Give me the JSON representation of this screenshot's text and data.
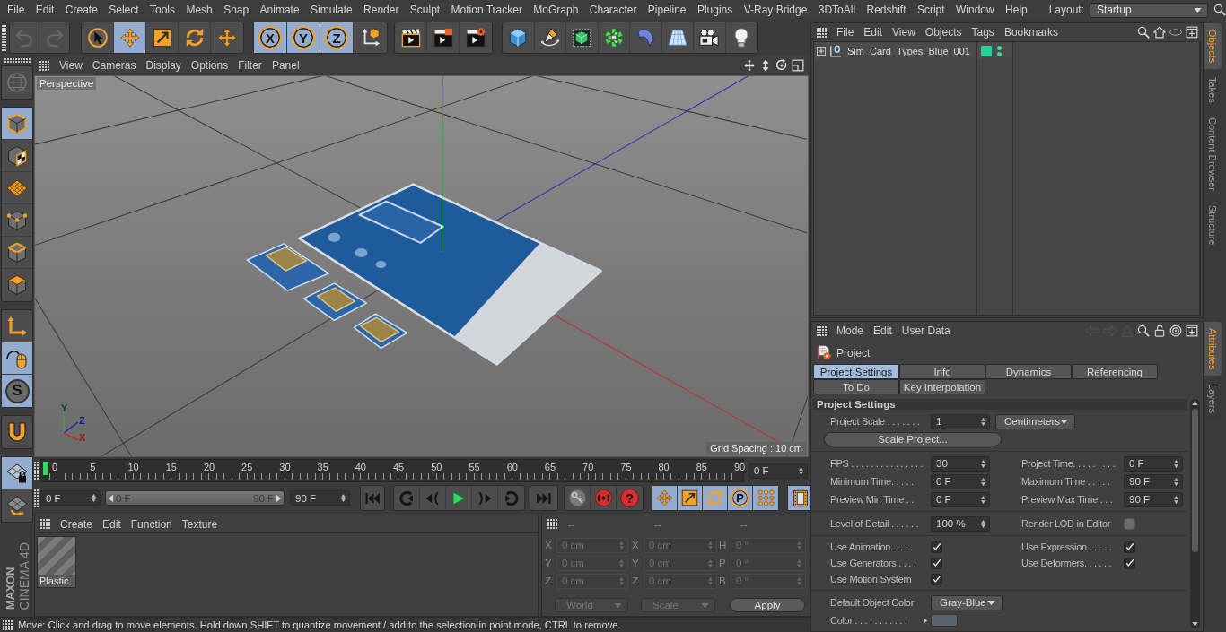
{
  "menu_bar": {
    "items": [
      "File",
      "Edit",
      "Create",
      "Select",
      "Tools",
      "Mesh",
      "Snap",
      "Animate",
      "Simulate",
      "Render",
      "Sculpt",
      "Motion Tracker",
      "MoGraph",
      "Character",
      "Pipeline",
      "Plugins",
      "V-Ray Bridge",
      "3DToAll",
      "Redshift",
      "Script",
      "Window",
      "Help"
    ],
    "layout_label": "Layout:",
    "layout": "Startup"
  },
  "toolbar": {
    "history": [
      {
        "disabled": true
      },
      {
        "disabled": true
      }
    ],
    "tools": [
      {
        "selected": false
      },
      {
        "selected": true
      },
      {
        "selected": false
      },
      {
        "selected": false
      },
      {
        "selected": false
      }
    ],
    "axis_locks": [
      {
        "label": "X",
        "selected": true
      },
      {
        "label": "Y",
        "selected": true
      },
      {
        "label": "Z",
        "selected": true
      }
    ]
  },
  "mode_toolbar": {
    "camera_button": {
      "disabled": true
    },
    "modes": [
      {
        "selected": true
      },
      {
        "selected": false
      },
      {
        "selected": false
      },
      {
        "selected": false
      },
      {
        "selected": false
      },
      {
        "selected": false
      }
    ],
    "helpers": [
      {
        "selected": false
      },
      {
        "selected": true
      },
      {
        "label": "S",
        "selected": true
      }
    ],
    "magnet": {
      "selected": false
    },
    "workplane": [
      {
        "selected": true
      },
      {
        "selected": false
      }
    ]
  },
  "viewport": {
    "menu": [
      "View",
      "Cameras",
      "Display",
      "Options",
      "Filter",
      "Panel"
    ],
    "camera": "Perspective",
    "grid_spacing": "Grid Spacing : 10 cm",
    "axis_labels": [
      "Y",
      "Z",
      "X"
    ]
  },
  "timeline": {
    "ticks": [
      "0",
      "5",
      "10",
      "15",
      "20",
      "25",
      "30",
      "35",
      "40",
      "45",
      "50",
      "55",
      "60",
      "65",
      "70",
      "75",
      "80",
      "85",
      "90"
    ],
    "playhead": {
      "level": 0
    },
    "frame_field": "0 F"
  },
  "transport": {
    "start": "0 F",
    "range": {
      "start": "0 F",
      "end": "90 F",
      "level": 1
    },
    "end": "90 F",
    "key_selection_label": "?",
    "key_tracks": [
      {
        "selected": true
      },
      {
        "selected": true
      },
      {
        "selected": true
      },
      {
        "label": "P",
        "selected": true
      },
      {
        "selected": true
      }
    ],
    "timeline_button": {
      "selected": true
    }
  },
  "material_manager": {
    "menu": [
      "Create",
      "Edit",
      "Function",
      "Texture"
    ],
    "materials": [
      {
        "name": "Plastic"
      }
    ]
  },
  "coordinates": {
    "disabled": true,
    "headers": [
      "--",
      "--",
      "--"
    ],
    "rows": [
      {
        "cells": [
          {
            "axis": "X",
            "value": "0 cm"
          },
          {
            "axis": "X",
            "value": "0 cm"
          },
          {
            "axis": "H",
            "value": "0 °"
          }
        ]
      },
      {
        "cells": [
          {
            "axis": "Y",
            "value": "0 cm"
          },
          {
            "axis": "Y",
            "value": "0 cm"
          },
          {
            "axis": "P",
            "value": "0 °"
          }
        ]
      },
      {
        "cells": [
          {
            "axis": "Z",
            "value": "0 cm"
          },
          {
            "axis": "Z",
            "value": "0 cm"
          },
          {
            "axis": "B",
            "value": "0 °"
          }
        ]
      }
    ],
    "dropdowns": [
      "World",
      "Scale"
    ],
    "apply": "Apply"
  },
  "logo": {
    "brand": "MAXON",
    "product": "CINEMA 4D"
  },
  "status_bar": "Move: Click and drag to move elements. Hold down SHIFT to quantize movement / add to the selection in point mode, CTRL to remove.",
  "object_manager": {
    "menu": [
      "File",
      "Edit",
      "View",
      "Objects",
      "Tags",
      "Bookmarks"
    ],
    "objects": [
      {
        "name": "Sim_Card_Types_Blue_001",
        "expanded": false,
        "color": "#22d39b",
        "editor_visible": true,
        "render_visible": true
      }
    ]
  },
  "dock_tabs_top": [
    {
      "label": "Objects",
      "selected": true
    },
    {
      "label": "Takes",
      "selected": false
    },
    {
      "label": "Content Browser",
      "selected": false
    },
    {
      "label": "Structure",
      "selected": false
    }
  ],
  "attributes": {
    "menu": [
      "Mode",
      "Edit",
      "User Data"
    ],
    "title": "Project",
    "tabs": [
      {
        "label": "Project Settings",
        "selected": true
      },
      {
        "label": "Info",
        "selected": false
      },
      {
        "label": "Dynamics",
        "selected": false
      },
      {
        "label": "Referencing",
        "selected": false
      },
      {
        "label": "To Do",
        "selected": false
      },
      {
        "label": "Key Interpolation",
        "selected": false
      }
    ],
    "section": "Project Settings",
    "groups": [
      {
        "rows": [
          [
            {
              "kind": "number",
              "label": "Project Scale . . . . . . .",
              "value": "1",
              "unit": "Centimeters"
            }
          ],
          [
            {
              "kind": "button",
              "label": "Scale Project..."
            }
          ]
        ]
      },
      {
        "rows": [
          [
            {
              "kind": "number",
              "label": "FPS . . . . . . . . . . . . . . .",
              "value": "30"
            },
            {
              "kind": "number",
              "label": "Project Time. . . . . . . . .",
              "value": "0 F"
            }
          ],
          [
            {
              "kind": "number",
              "label": "Minimum Time. . . . .",
              "value": "0 F"
            },
            {
              "kind": "number",
              "label": "Maximum Time . . . . .",
              "value": "90 F"
            }
          ],
          [
            {
              "kind": "number",
              "label": "Preview Min Time . .",
              "value": "0 F"
            },
            {
              "kind": "number",
              "label": "Preview Max Time . . .",
              "value": "90 F"
            }
          ]
        ]
      },
      {
        "rows": [
          [
            {
              "kind": "number",
              "label": "Level of Detail . . . . . .",
              "value": "100 %"
            },
            {
              "kind": "checkbox",
              "label": "Render LOD in Editor",
              "checked": false
            }
          ]
        ]
      },
      {
        "rows": [
          [
            {
              "kind": "checkbox",
              "label": "Use Animation. . . . .",
              "checked": true
            },
            {
              "kind": "checkbox",
              "label": "Use Expression . . . . .",
              "checked": true
            }
          ],
          [
            {
              "kind": "checkbox",
              "label": "Use Generators . . . .",
              "checked": true
            },
            {
              "kind": "checkbox",
              "label": "Use Deformers. . . . . .",
              "checked": true
            }
          ],
          [
            {
              "kind": "checkbox",
              "label": "Use Motion System",
              "checked": true
            }
          ]
        ]
      },
      {
        "rows": [
          [
            {
              "kind": "dropdown",
              "label": "Default Object Color",
              "value": "Gray-Blue"
            }
          ],
          [
            {
              "kind": "color",
              "label": "Color . . . . . . . . . . .",
              "color": "#59626c"
            }
          ]
        ]
      }
    ]
  },
  "dock_tabs_bottom": [
    {
      "label": "Attributes",
      "selected": true
    },
    {
      "label": "Layers",
      "selected": false
    }
  ]
}
